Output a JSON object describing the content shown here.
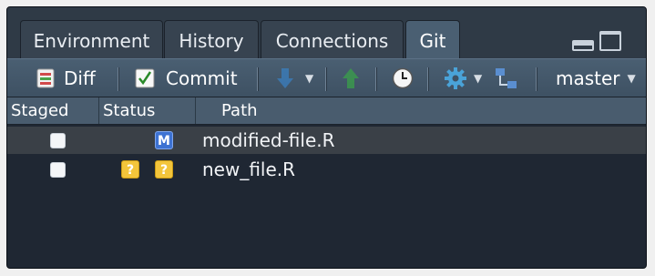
{
  "tabs": [
    {
      "label": "Environment",
      "active": false
    },
    {
      "label": "History",
      "active": false
    },
    {
      "label": "Connections",
      "active": false
    },
    {
      "label": "Git",
      "active": true
    }
  ],
  "toolbar": {
    "diff_label": "Diff",
    "commit_label": "Commit",
    "branch_label": "master"
  },
  "columns": {
    "staged": "Staged",
    "status": "Status",
    "path": "Path"
  },
  "files": [
    {
      "staged": false,
      "status_index": "",
      "status_worktree": "M",
      "path": "modified-file.R",
      "selected": true
    },
    {
      "staged": false,
      "status_index": "?",
      "status_worktree": "?",
      "path": "new_file.R",
      "selected": false
    }
  ],
  "colors": {
    "panel_bg": "#1f2733",
    "toolbar": "#4a5f72",
    "modified_badge": "#3d72d2",
    "untracked_badge": "#f3c53b"
  }
}
